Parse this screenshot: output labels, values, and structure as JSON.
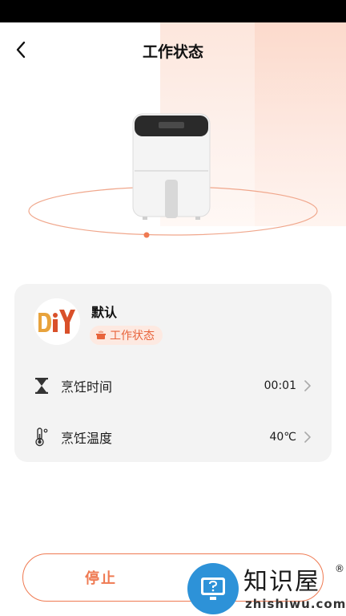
{
  "header": {
    "title": "工作状态",
    "back_icon": "chevron-left-icon"
  },
  "device": {
    "image": "air-fryer-image"
  },
  "mode": {
    "name": "默认",
    "avatar": "diy-logo",
    "status_chip": {
      "icon": "cooking-pot-icon",
      "label": "工作状态"
    }
  },
  "settings": [
    {
      "icon": "hourglass-icon",
      "label": "烹饪时间",
      "value": "00:01"
    },
    {
      "icon": "thermometer-icon",
      "label": "烹饪温度",
      "value": "40℃"
    }
  ],
  "actions": {
    "stop_label": "停止"
  },
  "watermark": {
    "brand": "知识屋",
    "reg_mark": "®",
    "url": "zhishiwu.com"
  },
  "colors": {
    "accent": "#ef7a52",
    "chip_bg": "#fde9e1",
    "card_bg": "#f3f3f3",
    "watermark_blue": "#2d92d8"
  }
}
